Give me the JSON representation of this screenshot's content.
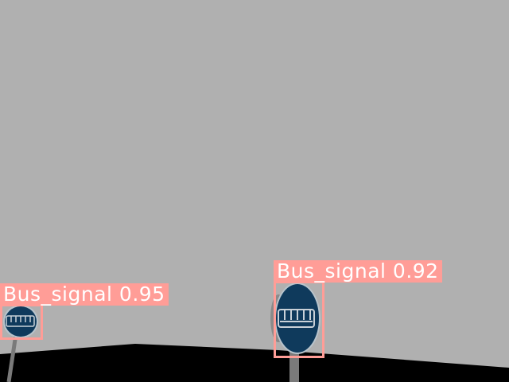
{
  "detections": [
    {
      "label": "Bus_signal 0.95",
      "class": "Bus_signal",
      "confidence": 0.95
    },
    {
      "label": "Bus_signal 0.92",
      "class": "Bus_signal",
      "confidence": 0.92
    }
  ],
  "colors": {
    "sky": "#b0b0b0",
    "ground": "#000000",
    "pole": "#7a7a7a",
    "sign_face": "#0f3a5c",
    "sign_rim": "#b8c4cc",
    "bus_glyph": "#c9d1d8",
    "detection_box": "#ff9d97",
    "label_text": "#ffffff"
  }
}
